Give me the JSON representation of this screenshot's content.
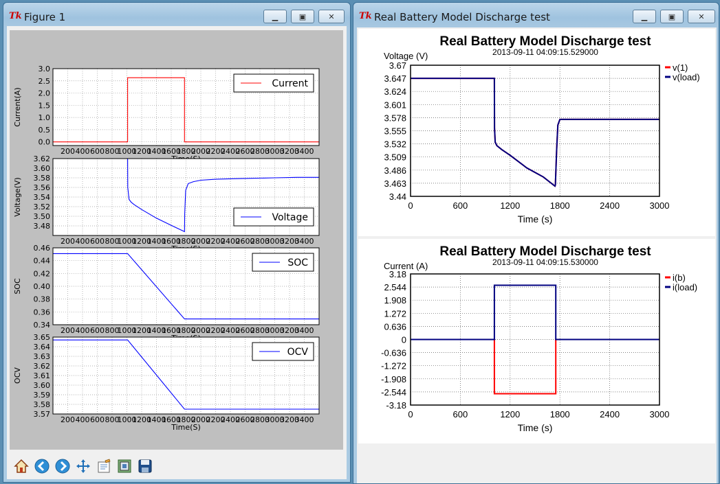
{
  "window1": {
    "title": "Figure 1",
    "toolbar_icons": [
      "home-icon",
      "back-icon",
      "forward-icon",
      "pan-icon",
      "subplots-icon",
      "zoom-rect-icon",
      "save-icon"
    ]
  },
  "window2": {
    "title": "Real Battery Model Discharge test"
  },
  "colors": {
    "red": "#ff0000",
    "blue": "#0000ff",
    "navy": "#000080",
    "plotbg": "#ffffff",
    "figbg": "#bfbfbf"
  },
  "chart_data": [
    {
      "type": "line",
      "id": "current",
      "xlabel": "Time(S)",
      "ylabel": "Current(A)",
      "xlim": [
        0,
        3600
      ],
      "ylim": [
        -0.15,
        3.0
      ],
      "yticks": [
        "0.0",
        "0.5",
        "1.0",
        "1.5",
        "2.0",
        "2.5",
        "3.0"
      ],
      "xticks": [
        "200",
        "400",
        "600",
        "800",
        "1000",
        "1200",
        "1400",
        "1600",
        "1800",
        "2000",
        "2200",
        "2400",
        "2600",
        "2800",
        "3000",
        "3200",
        "3400"
      ],
      "series": [
        {
          "name": "Current",
          "color": "#ff0000",
          "x": [
            0,
            1010,
            1010,
            1780,
            1780,
            3600
          ],
          "y": [
            0,
            0,
            2.63,
            2.63,
            0,
            0
          ]
        }
      ],
      "legend": "top-right"
    },
    {
      "type": "line",
      "id": "voltage",
      "xlabel": "Time(S)",
      "ylabel": "Voltage(V)",
      "xlim": [
        0,
        3600
      ],
      "ylim": [
        3.46,
        3.62
      ],
      "yticks": [
        "3.48",
        "3.50",
        "3.52",
        "3.54",
        "3.56",
        "3.58",
        "3.60",
        "3.62"
      ],
      "series": [
        {
          "name": "Voltage",
          "color": "#0000ff",
          "x": [
            0,
            1010,
            1012,
            1030,
            1060,
            1100,
            1200,
            1400,
            1600,
            1780,
            1782,
            1795,
            1830,
            1900,
            2000,
            2200,
            2400,
            2700,
            3000,
            3300,
            3600
          ],
          "y": [
            3.62,
            3.62,
            3.56,
            3.535,
            3.529,
            3.524,
            3.514,
            3.496,
            3.481,
            3.468,
            3.505,
            3.554,
            3.568,
            3.572,
            3.575,
            3.577,
            3.578,
            3.579,
            3.58,
            3.581,
            3.581
          ]
        }
      ],
      "legend": "bottom-right"
    },
    {
      "type": "line",
      "id": "soc",
      "xlabel": "Time(S)",
      "ylabel": "SOC",
      "xlim": [
        0,
        3600
      ],
      "ylim": [
        0.34,
        0.46
      ],
      "yticks": [
        "0.34",
        "0.36",
        "0.38",
        "0.40",
        "0.42",
        "0.44",
        "0.46"
      ],
      "series": [
        {
          "name": "SOC",
          "color": "#0000ff",
          "x": [
            0,
            1010,
            1780,
            3600
          ],
          "y": [
            0.451,
            0.451,
            0.349,
            0.349
          ]
        }
      ],
      "legend": "top-right"
    },
    {
      "type": "line",
      "id": "ocv",
      "xlabel": "Time(S)",
      "ylabel": "OCV",
      "xlim": [
        0,
        3600
      ],
      "ylim": [
        3.57,
        3.65
      ],
      "yticks": [
        "3.57",
        "3.58",
        "3.59",
        "3.60",
        "3.61",
        "3.62",
        "3.63",
        "3.64",
        "3.65"
      ],
      "series": [
        {
          "name": "OCV",
          "color": "#0000ff",
          "x": [
            0,
            1010,
            1780,
            3600
          ],
          "y": [
            3.647,
            3.647,
            3.575,
            3.575
          ]
        }
      ],
      "legend": "top-right"
    },
    {
      "type": "line",
      "id": "voltage_test",
      "title": "Real Battery Model Discharge test",
      "subtitle": "2013-09-11 04:09:15.529000",
      "xlabel": "Time (s)",
      "ylabel": "Voltage (V)",
      "xlim": [
        0,
        3000
      ],
      "ylim": [
        3.44,
        3.67
      ],
      "yticks": [
        "3.44",
        "3.463",
        "3.486",
        "3.509",
        "3.532",
        "3.555",
        "3.578",
        "3.601",
        "3.624",
        "3.647",
        "3.67"
      ],
      "xticks": [
        "0",
        "600",
        "1200",
        "1800",
        "2400",
        "3000"
      ],
      "series": [
        {
          "name": "v(1)",
          "color": "#ff0000",
          "x": [
            0,
            1010,
            1012,
            1020,
            1040,
            1100,
            1200,
            1400,
            1600,
            1740,
            1745,
            1760,
            1775,
            1800,
            3000
          ],
          "y": [
            3.647,
            3.647,
            3.56,
            3.535,
            3.529,
            3.522,
            3.512,
            3.49,
            3.474,
            3.458,
            3.46,
            3.52,
            3.565,
            3.575,
            3.575
          ]
        },
        {
          "name": "v(load)",
          "color": "#000080",
          "x": [
            0,
            1010,
            1012,
            1020,
            1040,
            1100,
            1200,
            1400,
            1600,
            1740,
            1745,
            1760,
            1775,
            1800,
            3000
          ],
          "y": [
            3.647,
            3.647,
            3.56,
            3.535,
            3.529,
            3.522,
            3.512,
            3.49,
            3.474,
            3.458,
            3.46,
            3.52,
            3.565,
            3.575,
            3.575
          ]
        }
      ],
      "legend": "outside-right"
    },
    {
      "type": "line",
      "id": "current_test",
      "title": "Real Battery Model Discharge test",
      "subtitle": "2013-09-11 04:09:15.530000",
      "xlabel": "Time (s)",
      "ylabel": "Current (A)",
      "xlim": [
        0,
        3000
      ],
      "ylim": [
        -3.18,
        3.18
      ],
      "yticks": [
        "-3.18",
        "-2.544",
        "-1.908",
        "-1.272",
        "-0.636",
        "0",
        "0.636",
        "1.272",
        "1.908",
        "2.544",
        "3.18"
      ],
      "xticks": [
        "0",
        "600",
        "1200",
        "1800",
        "2400",
        "3000"
      ],
      "series": [
        {
          "name": "i(b)",
          "color": "#ff0000",
          "x": [
            0,
            1010,
            1010,
            1750,
            1750,
            3000
          ],
          "y": [
            0,
            0,
            -2.63,
            -2.63,
            0,
            0
          ]
        },
        {
          "name": "i(load)",
          "color": "#000080",
          "x": [
            0,
            1010,
            1010,
            1750,
            1750,
            3000
          ],
          "y": [
            0,
            0,
            2.63,
            2.63,
            0,
            0
          ]
        }
      ],
      "legend": "outside-right"
    }
  ]
}
